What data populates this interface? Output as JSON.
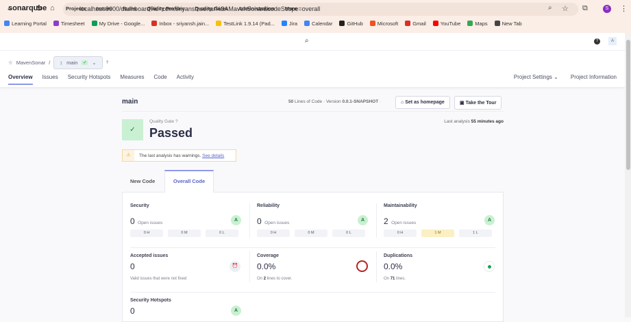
{
  "browser": {
    "url": "localhost:9000/dashboard?id=com.sriyansh.sonar%3AMavenSonar&codeScope=overall",
    "profile_initial": "S",
    "bookmarks": [
      {
        "label": "Learning Portal",
        "color": "#4285f4"
      },
      {
        "label": "Timesheet",
        "color": "#8a3fc9"
      },
      {
        "label": "My Drive - Google...",
        "color": "#0f9d58"
      },
      {
        "label": "Inbox - sriyansh.jain...",
        "color": "#d93025"
      },
      {
        "label": "TestLink 1.9.14 (Pad...",
        "color": "#f4c20d"
      },
      {
        "label": "Jira",
        "color": "#2684ff"
      },
      {
        "label": "Calendar",
        "color": "#4285f4"
      },
      {
        "label": "GitHub",
        "color": "#222222"
      },
      {
        "label": "Microsoft",
        "color": "#f25022"
      },
      {
        "label": "Gmail",
        "color": "#d93025"
      },
      {
        "label": "YouTube",
        "color": "#ff0000"
      },
      {
        "label": "Maps",
        "color": "#34a853"
      },
      {
        "label": "New Tab",
        "color": "#444444"
      }
    ]
  },
  "nav": {
    "logo": "sonarqube",
    "items": [
      "Projects",
      "Issues",
      "Rules",
      "Quality Profiles",
      "Quality Gates",
      "Administration",
      "More"
    ],
    "avatar": "A",
    "help": "?"
  },
  "breadcrumb": {
    "project": "MavenSonar",
    "branch": "main"
  },
  "project_tabs": [
    "Overview",
    "Issues",
    "Security Hotspots",
    "Measures",
    "Code",
    "Activity"
  ],
  "project_right": {
    "settings": "Project Settings",
    "info": "Project Information"
  },
  "header": {
    "branch": "main",
    "loc": "50",
    "loc_label": "Lines of Code",
    "version_label": "Version",
    "version": "0.0.1-SNAPSHOT",
    "set_home": "Set as homepage",
    "tour": "Take the Tour"
  },
  "gate": {
    "label": "Quality Gate",
    "status": "Passed",
    "last_label": "Last analysis",
    "last_value": "55 minutes ago"
  },
  "warning": {
    "text": "The last analysis has warnings.",
    "link": "See details"
  },
  "code_tabs": [
    "New Code",
    "Overall Code"
  ],
  "measures": {
    "security": {
      "title": "Security",
      "value": "0",
      "suffix": "Open issues",
      "rating": "A",
      "pills": [
        "0 H",
        "0 M",
        "0 L"
      ]
    },
    "reliability": {
      "title": "Reliability",
      "value": "0",
      "suffix": "Open issues",
      "rating": "A",
      "pills": [
        "0 H",
        "0 M",
        "0 L"
      ]
    },
    "maintainability": {
      "title": "Maintainability",
      "value": "2",
      "suffix": "Open issues",
      "rating": "A",
      "pills": [
        "0 H",
        "1 M",
        "1 L"
      ]
    },
    "accepted": {
      "title": "Accepted issues",
      "value": "0",
      "note": "Valid issues that were not fixed"
    },
    "coverage": {
      "title": "Coverage",
      "value": "0.0%",
      "note_pre": "On",
      "note_num": "2",
      "note_post": "lines to cover."
    },
    "duplications": {
      "title": "Duplications",
      "value": "0.0%",
      "note_pre": "On",
      "note_num": "71",
      "note_post": "lines."
    },
    "hotspots": {
      "title": "Security Hotspots",
      "value": "0",
      "rating": "A"
    }
  }
}
